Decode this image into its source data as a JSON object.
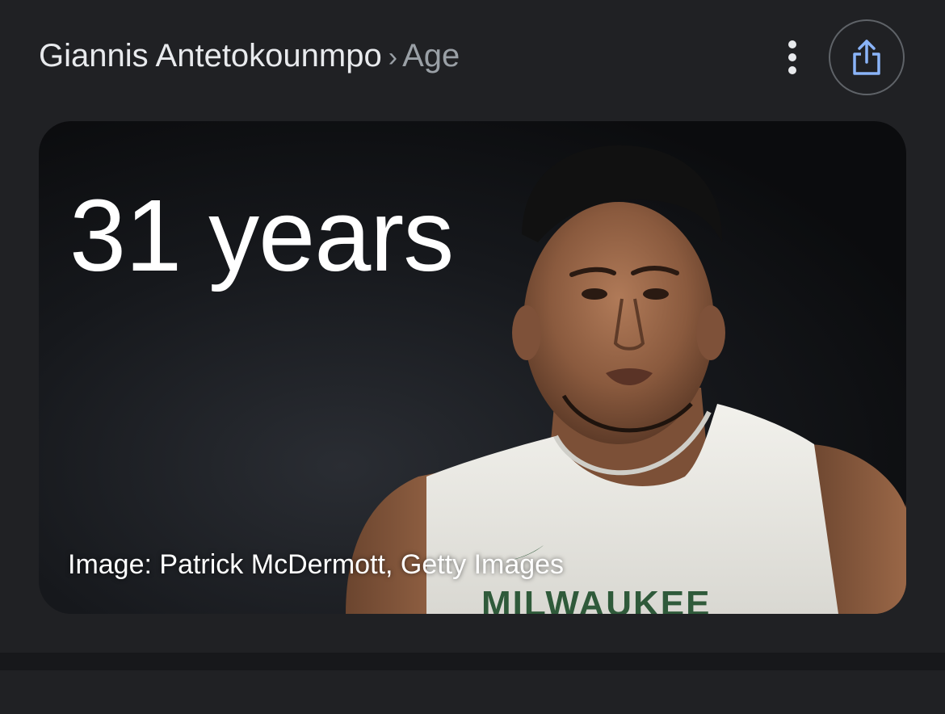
{
  "header": {
    "breadcrumb_parent": "Giannis Antetokounmpo",
    "breadcrumb_separator": "›",
    "breadcrumb_current": "Age",
    "more_icon": "more-vert-icon",
    "share_icon": "share-icon"
  },
  "card": {
    "age_value": "31 years",
    "image_credit": "Image: Patrick McDermott, Getty Images",
    "jersey_text": "MILWAUKEE"
  },
  "colors": {
    "background": "#202124",
    "text_primary": "#e8eaed",
    "text_secondary": "#9aa0a6",
    "share_accent": "#8ab4f8"
  }
}
